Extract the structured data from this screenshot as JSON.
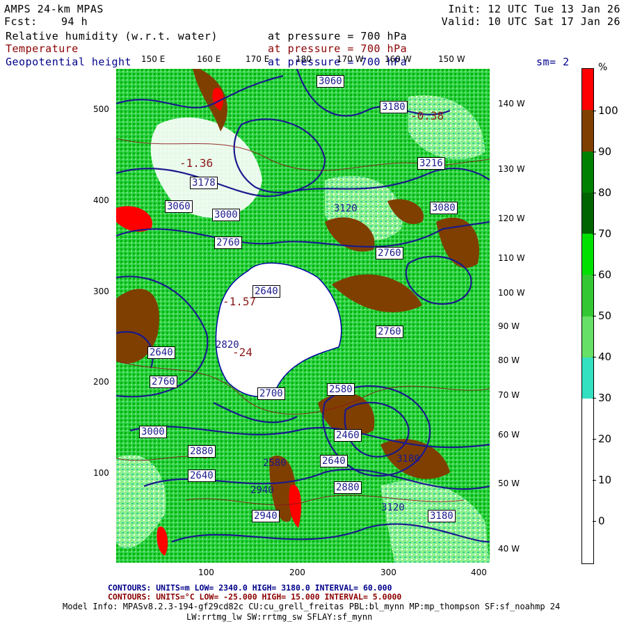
{
  "header": {
    "model": "AMPS 24-km MPAS",
    "forecast_label": "Fcst:",
    "forecast_hours": "94 h",
    "init": "Init: 12 UTC Tue 13 Jan 26",
    "valid": "Valid: 10 UTC Sat 17 Jan 26"
  },
  "fields": [
    {
      "name": "Relative humidity (w.r.t. water)",
      "level": "at pressure =  700 hPa",
      "color": "#000000"
    },
    {
      "name": "Temperature",
      "level": "at pressure =  700 hPa",
      "color": "#8b0000"
    },
    {
      "name": "Geopotential height",
      "level": "at pressure =  700 hPa",
      "color": "#00008b"
    }
  ],
  "smoothing": "sm= 2",
  "top_longitudes": [
    "150 E",
    "160 E",
    "170 E",
    "180",
    "170 W",
    "160 W",
    "150 W"
  ],
  "right_longitudes": [
    "140 W",
    "130 W",
    "120 W",
    "110 W",
    "100 W",
    "90 W",
    "80 W",
    "70 W",
    "60 W",
    "50 W",
    "40 W"
  ],
  "x_axis": [
    "100",
    "200",
    "300",
    "400"
  ],
  "y_axis": [
    "500",
    "400",
    "300",
    "200",
    "100"
  ],
  "colorbar": {
    "unit": "%",
    "labels": [
      "100",
      "90",
      "80",
      "70",
      "60",
      "50",
      "40",
      "30",
      "20",
      "10",
      "0"
    ],
    "colors": [
      "#ff0000",
      "#7f3f00",
      "#008000",
      "#006400",
      "#00e000",
      "#33c833",
      "#66e066",
      "#33e0c0",
      "#ffffff",
      "#ffffff",
      "#ffffff",
      "#ffffff"
    ]
  },
  "height_labels": [
    "3060",
    "3000",
    "2820",
    "2640",
    "2760",
    "2760",
    "2700",
    "2580",
    "2460",
    "2640",
    "2760",
    "2880",
    "2940",
    "3120",
    "3180",
    "3000",
    "2880",
    "2640",
    "2580",
    "2940",
    "3180",
    "3060",
    "3080",
    "3180",
    "3216",
    "3120",
    "3178",
    "2760",
    "2640"
  ],
  "temp_labels": [
    "-24",
    "-1.57",
    "-0.38",
    "-1.36"
  ],
  "footer": {
    "line1": "CONTOURS:  UNITS=m  LOW=  2340.0      HIGH=  3180.0      INTERVAL=   60.000",
    "line2": "CONTOURS:  UNITS=°C  LOW= -25.000      HIGH=  15.000      INTERVAL=   5.0000",
    "line3": "Model Info: MPASv8.2.3-194-gf29cd82c CU:cu_grell_freitas PBL:bl_mynn MP:mp_thompson SF:sf_noahmp 24",
    "line4": "LW:rrtmg_lw SW:rrtmg_sw SFLAY:sf_mynn"
  }
}
